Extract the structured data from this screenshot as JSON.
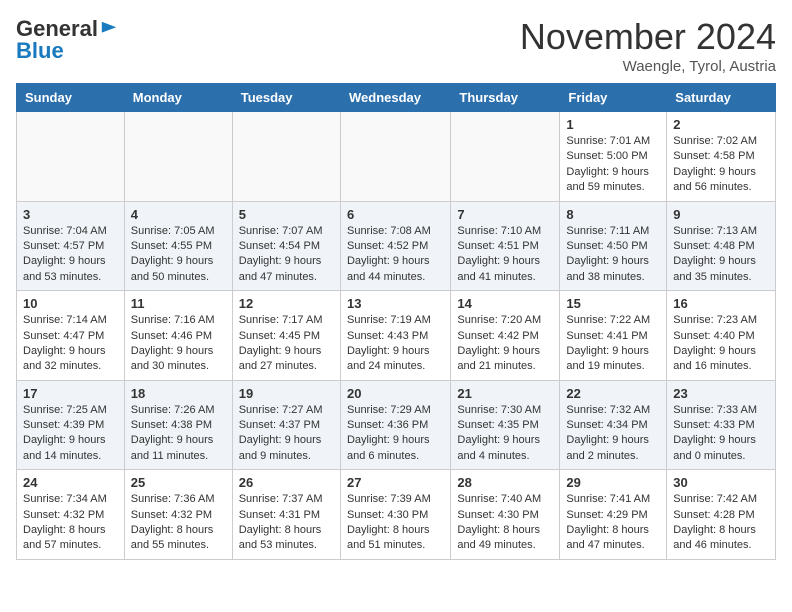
{
  "header": {
    "logo_general": "General",
    "logo_blue": "Blue",
    "month_title": "November 2024",
    "location": "Waengle, Tyrol, Austria"
  },
  "weekdays": [
    "Sunday",
    "Monday",
    "Tuesday",
    "Wednesday",
    "Thursday",
    "Friday",
    "Saturday"
  ],
  "weeks": [
    [
      {
        "day": "",
        "info": ""
      },
      {
        "day": "",
        "info": ""
      },
      {
        "day": "",
        "info": ""
      },
      {
        "day": "",
        "info": ""
      },
      {
        "day": "",
        "info": ""
      },
      {
        "day": "1",
        "info": "Sunrise: 7:01 AM\nSunset: 5:00 PM\nDaylight: 9 hours and 59 minutes."
      },
      {
        "day": "2",
        "info": "Sunrise: 7:02 AM\nSunset: 4:58 PM\nDaylight: 9 hours and 56 minutes."
      }
    ],
    [
      {
        "day": "3",
        "info": "Sunrise: 7:04 AM\nSunset: 4:57 PM\nDaylight: 9 hours and 53 minutes."
      },
      {
        "day": "4",
        "info": "Sunrise: 7:05 AM\nSunset: 4:55 PM\nDaylight: 9 hours and 50 minutes."
      },
      {
        "day": "5",
        "info": "Sunrise: 7:07 AM\nSunset: 4:54 PM\nDaylight: 9 hours and 47 minutes."
      },
      {
        "day": "6",
        "info": "Sunrise: 7:08 AM\nSunset: 4:52 PM\nDaylight: 9 hours and 44 minutes."
      },
      {
        "day": "7",
        "info": "Sunrise: 7:10 AM\nSunset: 4:51 PM\nDaylight: 9 hours and 41 minutes."
      },
      {
        "day": "8",
        "info": "Sunrise: 7:11 AM\nSunset: 4:50 PM\nDaylight: 9 hours and 38 minutes."
      },
      {
        "day": "9",
        "info": "Sunrise: 7:13 AM\nSunset: 4:48 PM\nDaylight: 9 hours and 35 minutes."
      }
    ],
    [
      {
        "day": "10",
        "info": "Sunrise: 7:14 AM\nSunset: 4:47 PM\nDaylight: 9 hours and 32 minutes."
      },
      {
        "day": "11",
        "info": "Sunrise: 7:16 AM\nSunset: 4:46 PM\nDaylight: 9 hours and 30 minutes."
      },
      {
        "day": "12",
        "info": "Sunrise: 7:17 AM\nSunset: 4:45 PM\nDaylight: 9 hours and 27 minutes."
      },
      {
        "day": "13",
        "info": "Sunrise: 7:19 AM\nSunset: 4:43 PM\nDaylight: 9 hours and 24 minutes."
      },
      {
        "day": "14",
        "info": "Sunrise: 7:20 AM\nSunset: 4:42 PM\nDaylight: 9 hours and 21 minutes."
      },
      {
        "day": "15",
        "info": "Sunrise: 7:22 AM\nSunset: 4:41 PM\nDaylight: 9 hours and 19 minutes."
      },
      {
        "day": "16",
        "info": "Sunrise: 7:23 AM\nSunset: 4:40 PM\nDaylight: 9 hours and 16 minutes."
      }
    ],
    [
      {
        "day": "17",
        "info": "Sunrise: 7:25 AM\nSunset: 4:39 PM\nDaylight: 9 hours and 14 minutes."
      },
      {
        "day": "18",
        "info": "Sunrise: 7:26 AM\nSunset: 4:38 PM\nDaylight: 9 hours and 11 minutes."
      },
      {
        "day": "19",
        "info": "Sunrise: 7:27 AM\nSunset: 4:37 PM\nDaylight: 9 hours and 9 minutes."
      },
      {
        "day": "20",
        "info": "Sunrise: 7:29 AM\nSunset: 4:36 PM\nDaylight: 9 hours and 6 minutes."
      },
      {
        "day": "21",
        "info": "Sunrise: 7:30 AM\nSunset: 4:35 PM\nDaylight: 9 hours and 4 minutes."
      },
      {
        "day": "22",
        "info": "Sunrise: 7:32 AM\nSunset: 4:34 PM\nDaylight: 9 hours and 2 minutes."
      },
      {
        "day": "23",
        "info": "Sunrise: 7:33 AM\nSunset: 4:33 PM\nDaylight: 9 hours and 0 minutes."
      }
    ],
    [
      {
        "day": "24",
        "info": "Sunrise: 7:34 AM\nSunset: 4:32 PM\nDaylight: 8 hours and 57 minutes."
      },
      {
        "day": "25",
        "info": "Sunrise: 7:36 AM\nSunset: 4:32 PM\nDaylight: 8 hours and 55 minutes."
      },
      {
        "day": "26",
        "info": "Sunrise: 7:37 AM\nSunset: 4:31 PM\nDaylight: 8 hours and 53 minutes."
      },
      {
        "day": "27",
        "info": "Sunrise: 7:39 AM\nSunset: 4:30 PM\nDaylight: 8 hours and 51 minutes."
      },
      {
        "day": "28",
        "info": "Sunrise: 7:40 AM\nSunset: 4:30 PM\nDaylight: 8 hours and 49 minutes."
      },
      {
        "day": "29",
        "info": "Sunrise: 7:41 AM\nSunset: 4:29 PM\nDaylight: 8 hours and 47 minutes."
      },
      {
        "day": "30",
        "info": "Sunrise: 7:42 AM\nSunset: 4:28 PM\nDaylight: 8 hours and 46 minutes."
      }
    ]
  ]
}
